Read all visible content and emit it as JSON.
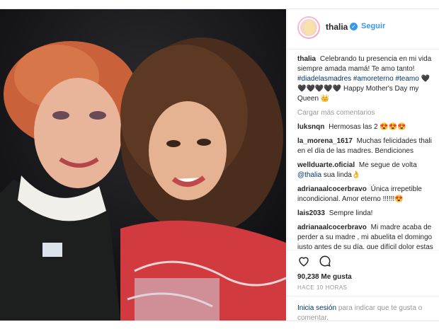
{
  "post": {
    "username": "thalia",
    "verified_badge": "✓",
    "separator": "•",
    "follow_label": "Seguir",
    "caption_user": "thalia",
    "caption_text": "Celebrando tu presencia en mi vida siempre amada mamá! Te amo tanto!",
    "caption_tags": "#diadelasmadres #amoreterno #teamo",
    "caption_emoji": "🖤🖤🖤🖤🖤🖤",
    "caption_end": "Happy Mother's Day my Queen 👑",
    "load_more": "Cargar más comentarios",
    "comments": [
      {
        "user": "luksnqn",
        "text": "Hermosas las 2 😍😍😍"
      },
      {
        "user": "la_morena_1617",
        "text": "Muchas felicidades thali en el día de las madres. Bendiciones"
      },
      {
        "user": "wellduarte.oficial",
        "text": "Me segue de volta",
        "tag": "@thalia",
        "tail": "sua linda👌"
      },
      {
        "user": "adrianaalcocerbravo",
        "text": "Única irrepetible incondicional. Amor eterno !!!!!!😍"
      },
      {
        "user": "lais2033",
        "text": "Sempre linda!"
      },
      {
        "user": "adrianaalcocerbravo",
        "text": "Mi madre acaba de perder a su madre , mi abuelita el domingo justo antes de su día, que difícil dolor estas fechas"
      }
    ],
    "likes": "90,238 Me gusta",
    "time": "HACE 10 HORAS",
    "login_link": "Inicia sesión",
    "login_text": "para indicar que te gusta o comentar.",
    "icons": {
      "like": "heart-icon",
      "comment": "comment-icon"
    },
    "colors": {
      "link": "#3897f0",
      "tag": "#003569",
      "muted": "#999999"
    }
  }
}
